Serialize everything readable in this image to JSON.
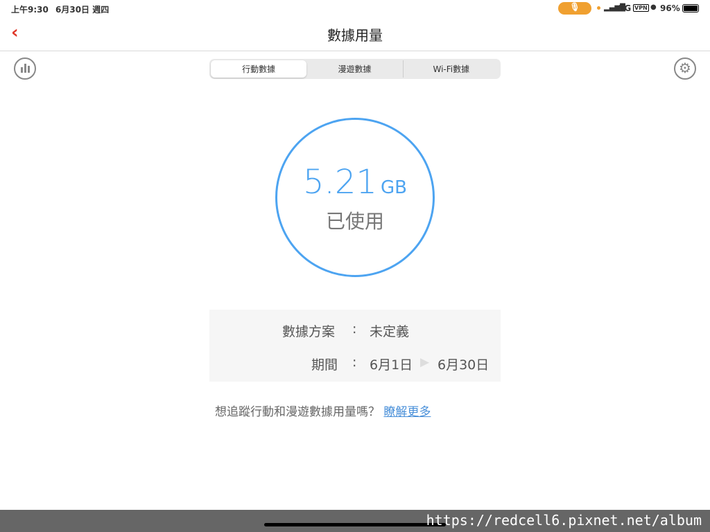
{
  "status_bar": {
    "time": "上午9:30",
    "date": "6月30日 週四",
    "network": "5G",
    "vpn": "VPN",
    "battery": "96%"
  },
  "nav": {
    "title": "數據用量"
  },
  "tabs": [
    {
      "label": "行動數據"
    },
    {
      "label": "漫遊數據"
    },
    {
      "label": "Wi-Fi數據"
    }
  ],
  "usage": {
    "value": "5.21",
    "unit": "GB",
    "label": "已使用"
  },
  "plan": {
    "label": "數據方案",
    "sep": ":",
    "value": "未定義",
    "period_label": "期間",
    "start": "6月1日",
    "end": "6月30日"
  },
  "prompt": {
    "text": "想追蹤行動和漫遊數據用量嗎？",
    "link": "瞭解更多"
  },
  "watermark": "https://redcell6.pixnet.net/album",
  "colors": {
    "accent": "#4da4f1",
    "back": "#e0392b",
    "mic": "#f0a030"
  }
}
